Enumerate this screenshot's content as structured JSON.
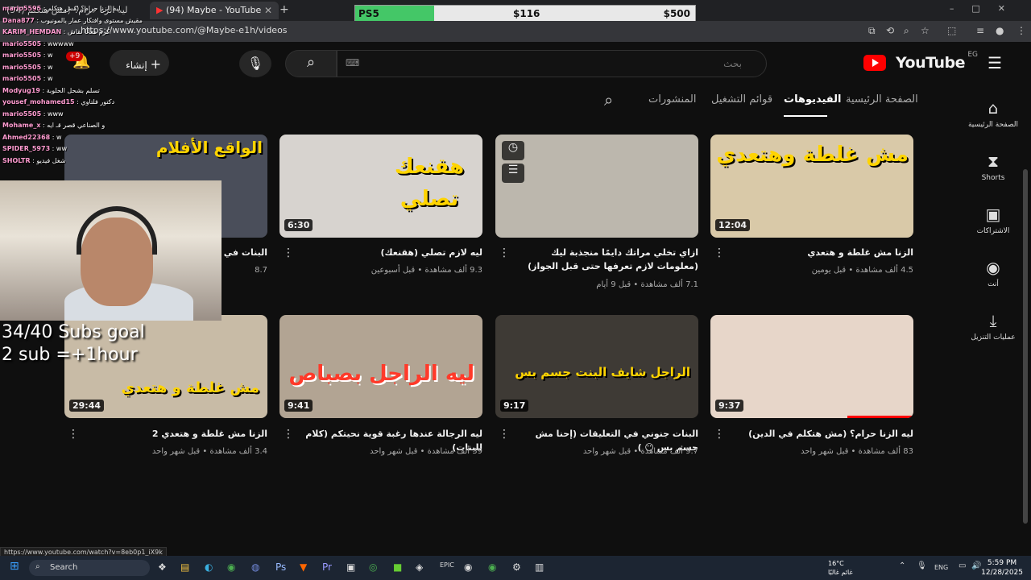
{
  "browser": {
    "tabs": [
      {
        "label": "(94) ليه الزنا حرام؟ (مش هتكلم",
        "active": false
      },
      {
        "label": "(94) Maybe - YouTube",
        "active": true
      }
    ],
    "new_tab": "+",
    "url": "https://www.youtube.com/@Maybe-e1h/videos",
    "status_url": "https://www.youtube.com/watch?v=8eb0p1_iX9k"
  },
  "goal_bar": {
    "label": "PS5",
    "current": "$116",
    "target": "$500",
    "progress": 0.232
  },
  "header": {
    "logo": "YouTube",
    "region": "EG",
    "search_placeholder": "بحث",
    "create_label": "إنشاء",
    "notifications_badge": "+9"
  },
  "channel_tabs": [
    {
      "label": "الصفحة الرئيسية",
      "active": false
    },
    {
      "label": "الفيديوهات",
      "active": true
    },
    {
      "label": "قوائم التشغيل",
      "active": false
    },
    {
      "label": "المنشورات",
      "active": false
    }
  ],
  "sidebar": [
    {
      "icon": "home-icon",
      "label": "الصفحة الرئيسية"
    },
    {
      "icon": "shorts-icon",
      "label": "Shorts"
    },
    {
      "icon": "subscriptions-icon",
      "label": "الاشتراكات"
    },
    {
      "icon": "you-icon",
      "label": "أنت"
    },
    {
      "icon": "downloads-icon",
      "label": "عمليات التنزيل"
    }
  ],
  "videos": [
    {
      "title": "الزنا مش غلطة و هتعدي",
      "views": "4.5 ألف مشاهدة",
      "age": "قبل يومين",
      "duration": "12:04",
      "thumb_text": "مش غلطة وهتعدي",
      "bg": "#d9c9a8"
    },
    {
      "title": "ازاي تخلي مراتك دايمًا منجذبة ليك (معلومات لازم تعرفها حتى قبل الجواز)",
      "views": "7.1 ألف مشاهدة",
      "age": "قبل 9 أيام",
      "duration": "",
      "thumb_text": "",
      "bg": "#bcb7ad"
    },
    {
      "title": "ليه لازم تصلي (هقنعك)",
      "views": "9.3 ألف مشاهدة",
      "age": "قبل أسبوعين",
      "duration": "6:30",
      "thumb_text": "هقنعك تصلي",
      "bg": "#d7d3cf"
    },
    {
      "title": "البنات في الا...",
      "views": "8.7",
      "age": "",
      "duration": "",
      "thumb_text": "الواقع الأفلام",
      "bg": "#4a4e5a"
    },
    {
      "title": "ليه الزنا حرام؟ (مش هتكلم في الدين)",
      "views": "83 ألف مشاهدة",
      "age": "قبل شهر واحد",
      "duration": "9:37",
      "thumb_text": "",
      "bg": "#e7d6c9"
    },
    {
      "title": "البنات جنوني في التعليقات (إحنا مش جسم بس 😶 )",
      "views": "9.7 ألف مشاهدة",
      "age": "قبل شهر واحد",
      "duration": "9:17",
      "thumb_text": "الراجل شايف البنت جسم بس",
      "bg": "#3e3a35"
    },
    {
      "title": "ليه الرجالة عندها رغبة قوية نحيتكم (كلام للبنات)",
      "views": "39 ألف مشاهدة",
      "age": "قبل شهر واحد",
      "duration": "9:41",
      "thumb_text": "ليه الراجل بصباص",
      "bg": "#b2a493"
    },
    {
      "title": "الزنا مش غلطة و هتعدي 2",
      "views": "3.4 ألف مشاهدة",
      "age": "قبل شهر واحد",
      "duration": "29:44",
      "thumb_text": "مش غلطة و هتعدي",
      "bg": "#c8bba6"
    }
  ],
  "stream_overlay": {
    "chat": [
      {
        "user": "mario5595",
        "msg": "ليه الزنا حرام؟ (مش هتكلم"
      },
      {
        "user": "Dana877",
        "msg": "مقيش مستوى وافتكار عمار يالمونيوب"
      },
      {
        "user": "KARIM_HEMDAN",
        "msg": "كرم معانا نقاش"
      },
      {
        "user": "mario5505",
        "msg": "wwwww"
      },
      {
        "user": "mario5505",
        "msg": "w"
      },
      {
        "user": "mario5505",
        "msg": "w"
      },
      {
        "user": "mario5505",
        "msg": "w"
      },
      {
        "user": "Modyug19",
        "msg": "تسلم بشحل الحلوبة"
      },
      {
        "user": "yousef_mohamed15",
        "msg": "دكتور فلتاوي"
      },
      {
        "user": "mario5505",
        "msg": "www"
      },
      {
        "user": "Mohame_x",
        "msg": "و الصناعي قصر قـ ايه"
      },
      {
        "user": "Ahmed22368",
        "msg": "w"
      },
      {
        "user": "SPIDER_5973",
        "msg": "ww"
      },
      {
        "user": "SHOLTR",
        "msg": "شغل فيديو"
      }
    ],
    "goal_line1": "34/40 Subs goal",
    "goal_line2": "2 sub =+1hour"
  },
  "taskbar": {
    "search": "Search",
    "weather_temp": "16°C",
    "weather_desc": "غائم غالبًا",
    "lang": "ENG",
    "time": "5:59 PM",
    "date": "12/28/2025"
  },
  "colors": {
    "accent": "#ff0000",
    "goal_fill": "#44c767",
    "background": "#0f0f0f"
  }
}
